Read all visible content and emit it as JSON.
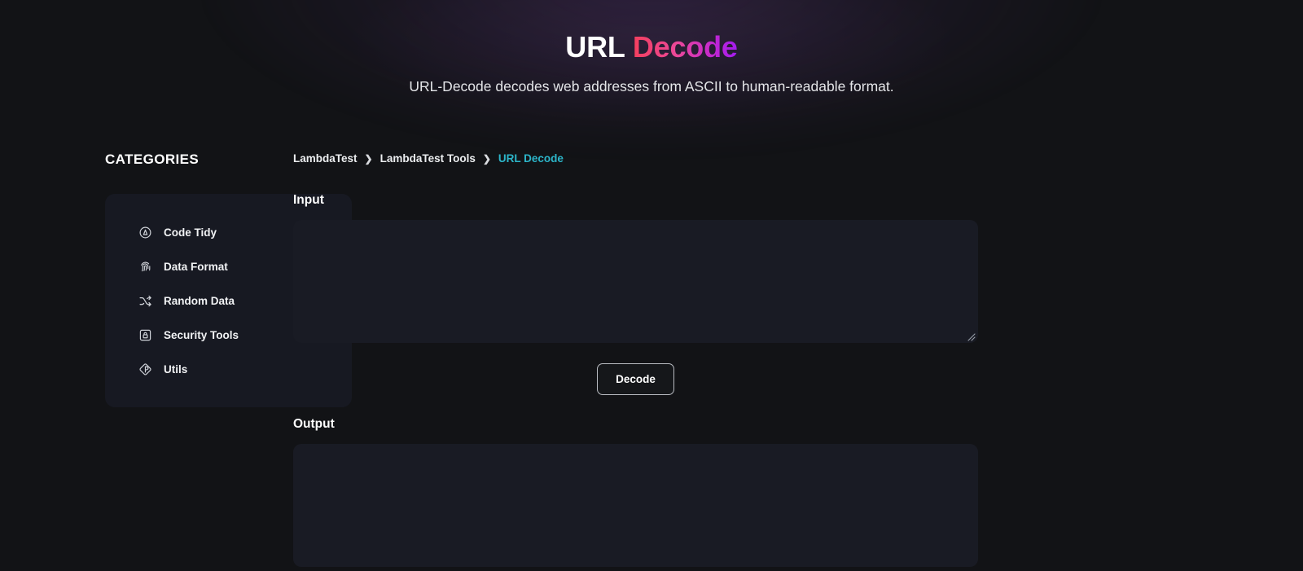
{
  "header": {
    "title_plain": "URL",
    "title_accent": "Decode",
    "subtitle": "URL-Decode decodes web addresses from ASCII to human-readable format."
  },
  "sidebar": {
    "heading": "CATEGORIES",
    "items": [
      {
        "label": "Code Tidy",
        "icon": "code-tidy-icon"
      },
      {
        "label": "Data Format",
        "icon": "fingerprint-icon"
      },
      {
        "label": "Random Data",
        "icon": "shuffle-icon"
      },
      {
        "label": "Security Tools",
        "icon": "lock-square-icon"
      },
      {
        "label": "Utils",
        "icon": "diamond-icon"
      }
    ]
  },
  "breadcrumb": {
    "items": [
      {
        "label": "LambdaTest",
        "current": false
      },
      {
        "label": "LambdaTest Tools",
        "current": false
      },
      {
        "label": "URL Decode",
        "current": true
      }
    ],
    "separator": "❯"
  },
  "main": {
    "input_label": "Input",
    "input_value": "",
    "input_placeholder": "",
    "decode_button": "Decode",
    "output_label": "Output",
    "output_value": "",
    "output_placeholder": ""
  },
  "colors": {
    "background": "#121316",
    "card": "#171922",
    "field": "#191b24",
    "accent_start": "#f43f5e",
    "accent_end": "#a21cf0",
    "breadcrumb_current": "#2cb5c9",
    "text": "#e9eaec"
  }
}
